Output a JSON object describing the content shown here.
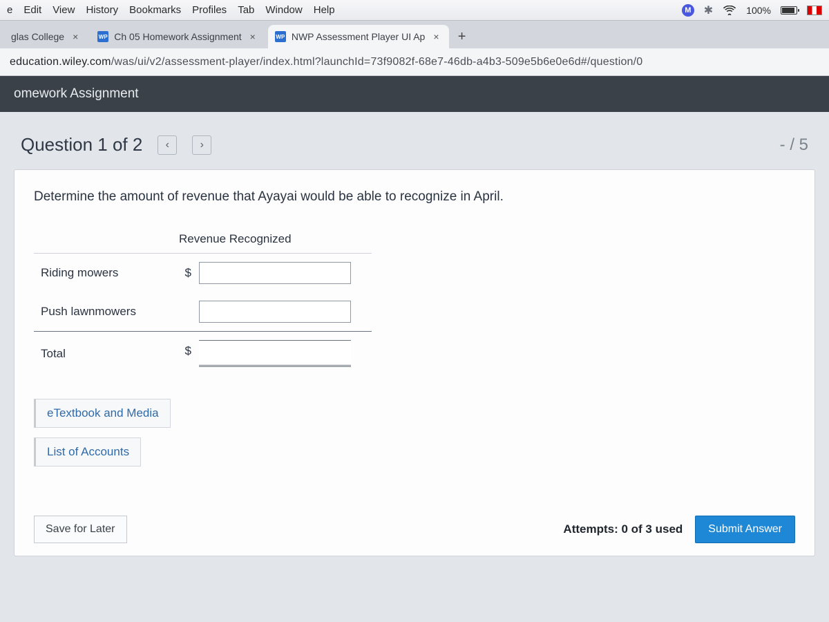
{
  "mac_menu": {
    "items": [
      "e",
      "Edit",
      "View",
      "History",
      "Bookmarks",
      "Profiles",
      "Tab",
      "Window",
      "Help"
    ],
    "status_letter": "M",
    "battery_pct": "100%"
  },
  "tabs": {
    "t0": {
      "title": "glas College"
    },
    "t1": {
      "favicon": "WP",
      "title": "Ch 05 Homework Assignment"
    },
    "t2": {
      "favicon": "WP",
      "title": "NWP Assessment Player UI Ap"
    }
  },
  "url": {
    "domain": "education.wiley.com",
    "path": "/was/ui/v2/assessment-player/index.html?launchId=73f9082f-68e7-46db-a4b3-509e5b6e0e6d#/question/0"
  },
  "app_header": "omework Assignment",
  "question": {
    "title": "Question 1 of 2",
    "score": "- / 5",
    "prompt": "Determine the amount of revenue that Ayayai would be able to recognize in April.",
    "col_header": "Revenue Recognized",
    "rows": {
      "r0": "Riding mowers",
      "r1": "Push lawnmowers",
      "r2": "Total"
    },
    "currency": "$"
  },
  "links": {
    "etext": "eTextbook and Media",
    "accounts": "List of Accounts"
  },
  "footer": {
    "save": "Save for Later",
    "attempts": "Attempts: 0 of 3 used",
    "submit": "Submit Answer"
  }
}
